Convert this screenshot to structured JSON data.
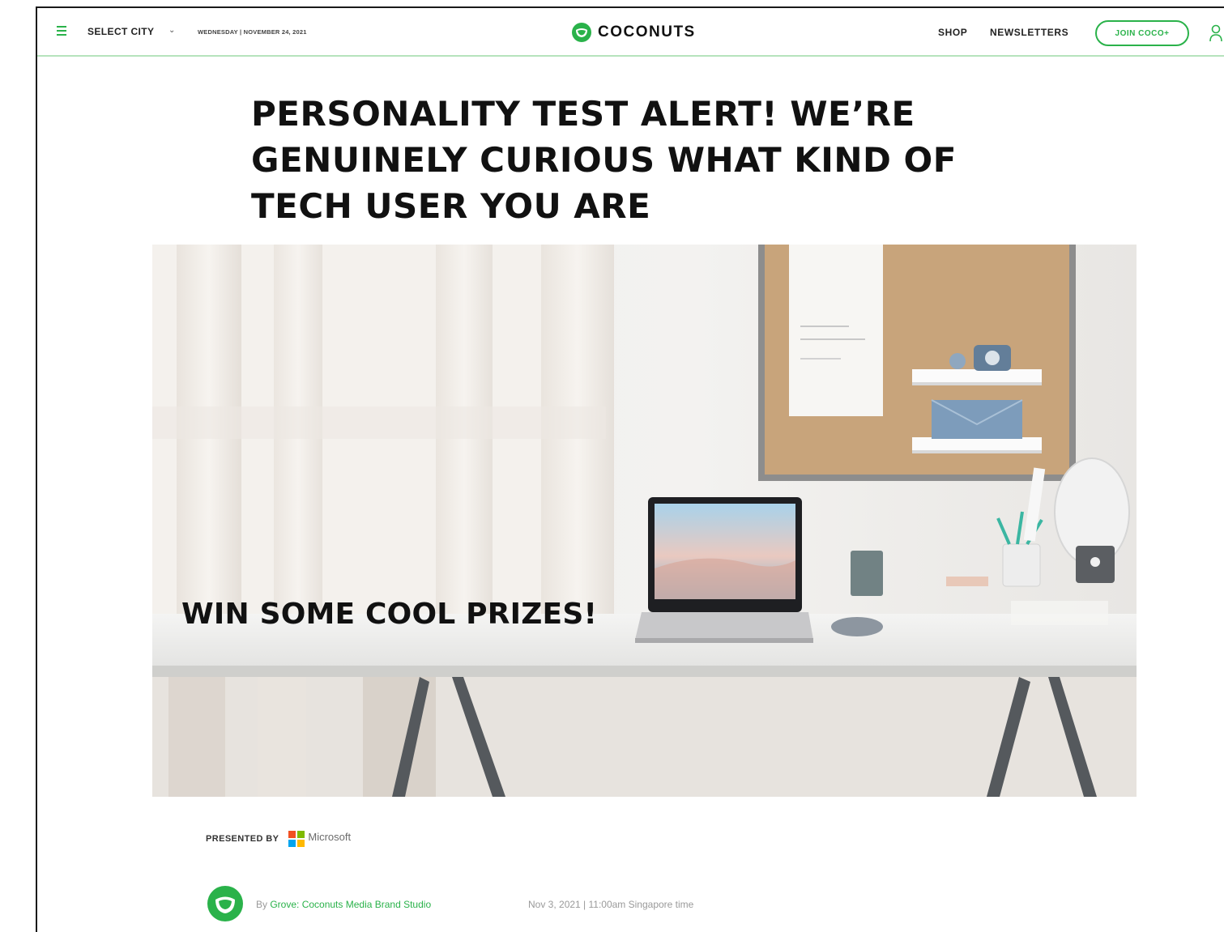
{
  "nav": {
    "city_label": "SELECT CITY",
    "date": "WEDNESDAY | NOVEMBER 24, 2021",
    "logo_text": "COCONUTS",
    "shop": "SHOP",
    "newsletters": "NEWSLETTERS",
    "join": "JOIN COCO+"
  },
  "article": {
    "headline": "PERSONALITY TEST ALERT! WE’RE GENUINELY CURIOUS WHAT KIND OF TECH USER YOU ARE",
    "hero_caption": "WIN SOME COOL PRIZES!",
    "presented_by": "PRESENTED BY",
    "sponsor": "Microsoft",
    "byline_prefix": "By ",
    "author": "Grove: Coconuts Media Brand Studio",
    "published": "Nov 3, 2021 | 11:00am Singapore time"
  },
  "colors": {
    "brand_green": "#2ab24a",
    "nav_border": "#b6e3bc",
    "ms_red": "#f25022",
    "ms_green": "#7fba00",
    "ms_blue": "#00a4ef",
    "ms_yellow": "#ffb900"
  }
}
